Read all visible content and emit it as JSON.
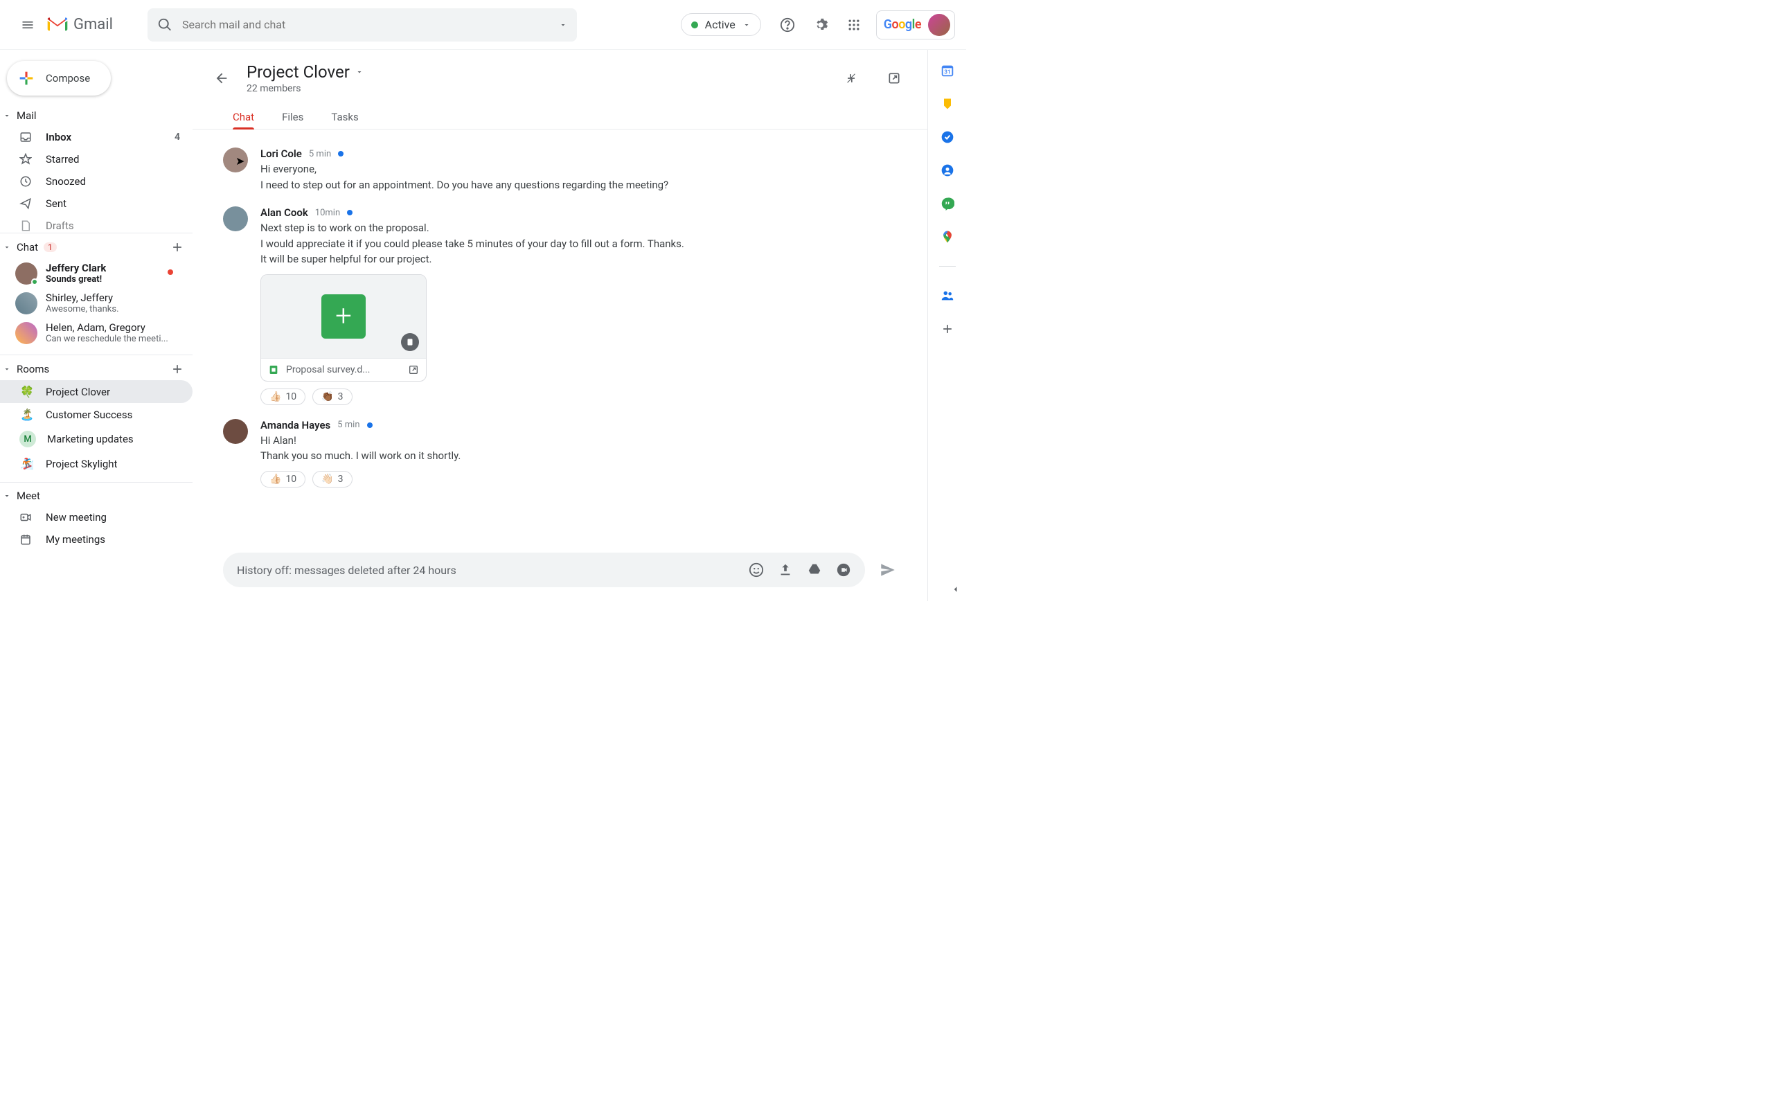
{
  "header": {
    "app_name": "Gmail",
    "search_placeholder": "Search mail and chat",
    "status_label": "Active"
  },
  "compose_label": "Compose",
  "sections": {
    "mail": {
      "label": "Mail"
    },
    "chat": {
      "label": "Chat",
      "badge": "1"
    },
    "rooms": {
      "label": "Rooms"
    },
    "meet": {
      "label": "Meet"
    }
  },
  "mail_items": [
    {
      "label": "Inbox",
      "count": "4",
      "bold": true
    },
    {
      "label": "Starred"
    },
    {
      "label": "Snoozed"
    },
    {
      "label": "Sent"
    },
    {
      "label": "Drafts"
    }
  ],
  "chat_items": [
    {
      "name": "Jeffery Clark",
      "preview": "Sounds great!",
      "unread": true,
      "bold": true
    },
    {
      "name": "Shirley, Jeffery",
      "preview": "Awesome, thanks."
    },
    {
      "name": "Helen, Adam, Gregory",
      "preview": "Can we reschedule the meeti..."
    }
  ],
  "room_items": [
    {
      "emoji": "🍀",
      "label": "Project Clover",
      "active": true
    },
    {
      "emoji": "🏝️",
      "label": "Customer Success"
    },
    {
      "emoji": "M",
      "label": "Marketing updates",
      "letter": true
    },
    {
      "emoji": "🏂",
      "label": "Project Skylight"
    }
  ],
  "meet_items": [
    {
      "label": "New meeting"
    },
    {
      "label": "My meetings"
    }
  ],
  "room": {
    "title": "Project Clover",
    "subtitle": "22 members",
    "tabs": [
      "Chat",
      "Files",
      "Tasks"
    ],
    "active_tab": 0
  },
  "messages": [
    {
      "name": "Lori Cole",
      "time": "5 min",
      "body": "Hi everyone,\nI need to step out for an appointment. Do you have any questions regarding the meeting?"
    },
    {
      "name": "Alan Cook",
      "time": "10min",
      "body": "Next step is to work on the proposal.\nI would appreciate it if you could please take 5 minutes of your day to fill out a form. Thanks.\nIt will be super helpful for our project.",
      "attachment": {
        "filename": "Proposal survey.d..."
      },
      "reactions": [
        {
          "emoji": "👍🏻",
          "count": "10"
        },
        {
          "emoji": "👏🏾",
          "count": "3"
        }
      ]
    },
    {
      "name": "Amanda Hayes",
      "time": "5 min",
      "body": "Hi Alan!\nThank you so much. I will work on it shortly.",
      "reactions": [
        {
          "emoji": "👍🏻",
          "count": "10"
        },
        {
          "emoji": "👋🏻",
          "count": "3"
        }
      ]
    }
  ],
  "composer": {
    "placeholder": "History off: messages deleted after 24 hours"
  }
}
